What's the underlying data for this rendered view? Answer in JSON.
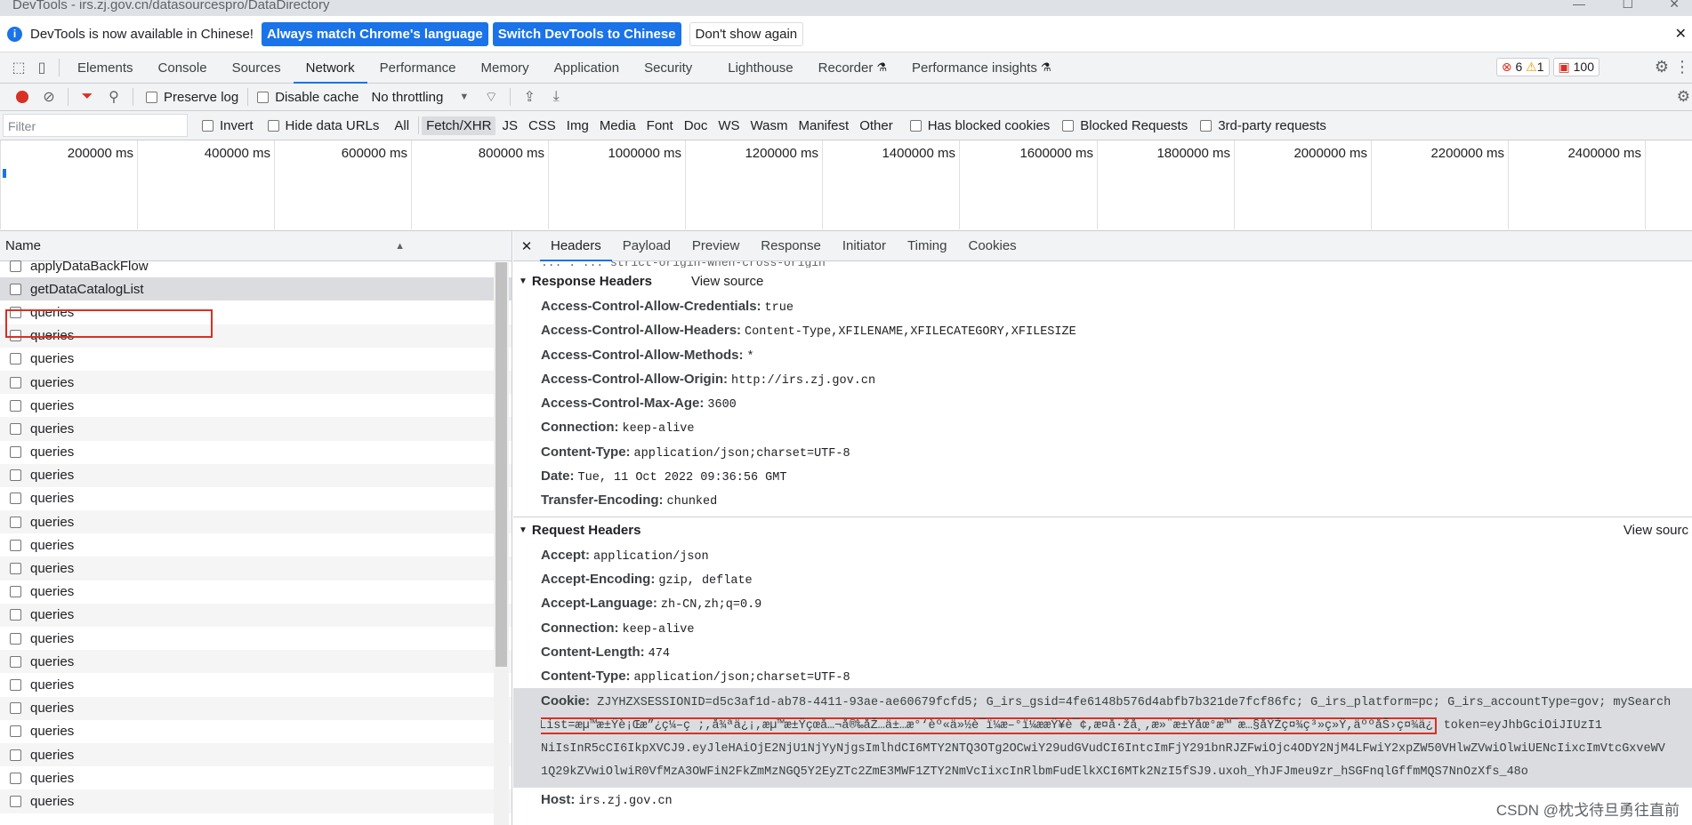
{
  "window": {
    "title": "DevTools - irs.zj.gov.cn/datasourcespro/DataDirectory"
  },
  "infobar": {
    "message": "DevTools is now available in Chinese!",
    "btn_match": "Always match Chrome's language",
    "btn_switch": "Switch DevTools to Chinese",
    "btn_dont_show": "Don't show again"
  },
  "tabs": [
    "Elements",
    "Console",
    "Sources",
    "Network",
    "Performance",
    "Memory",
    "Application",
    "Security",
    "Lighthouse",
    "Recorder",
    "Performance insights"
  ],
  "badges": {
    "errors": "6",
    "warnings": "1",
    "issues": "100"
  },
  "toolbar": {
    "preserve_log": "Preserve log",
    "disable_cache": "Disable cache",
    "throttling": "No throttling"
  },
  "filterbar": {
    "placeholder": "Filter",
    "invert": "Invert",
    "hide_data_urls": "Hide data URLs",
    "types": [
      "All",
      "Fetch/XHR",
      "JS",
      "CSS",
      "Img",
      "Media",
      "Font",
      "Doc",
      "WS",
      "Wasm",
      "Manifest",
      "Other"
    ],
    "has_blocked_cookies": "Has blocked cookies",
    "blocked_requests": "Blocked Requests",
    "third_party": "3rd-party requests"
  },
  "timeline": {
    "ticks": [
      "200000 ms",
      "400000 ms",
      "600000 ms",
      "800000 ms",
      "1000000 ms",
      "1200000 ms",
      "1400000 ms",
      "1600000 ms",
      "1800000 ms",
      "2000000 ms",
      "2200000 ms",
      "2400000 ms"
    ]
  },
  "requests": {
    "header": "Name",
    "items": [
      "applyDataBackFlow",
      "getDataCatalogList",
      "queries",
      "queries",
      "queries",
      "queries",
      "queries",
      "queries",
      "queries",
      "queries",
      "queries",
      "queries",
      "queries",
      "queries",
      "queries",
      "queries",
      "queries",
      "queries",
      "queries",
      "queries",
      "queries",
      "queries",
      "queries",
      "queries"
    ]
  },
  "detail": {
    "tabs": [
      "Headers",
      "Payload",
      "Preview",
      "Response",
      "Initiator",
      "Timing",
      "Cookies"
    ],
    "response_section": "Response Headers",
    "request_section": "Request Headers",
    "view_source": "View source",
    "view_source_right": "View sourc",
    "response_headers": [
      {
        "k": "Access-Control-Allow-Credentials:",
        "v": "true"
      },
      {
        "k": "Access-Control-Allow-Headers:",
        "v": "Content-Type,XFILENAME,XFILECATEGORY,XFILESIZE"
      },
      {
        "k": "Access-Control-Allow-Methods:",
        "v": "*"
      },
      {
        "k": "Access-Control-Allow-Origin:",
        "v": "http://irs.zj.gov.cn"
      },
      {
        "k": "Access-Control-Max-Age:",
        "v": "3600"
      },
      {
        "k": "Connection:",
        "v": "keep-alive"
      },
      {
        "k": "Content-Type:",
        "v": "application/json;charset=UTF-8"
      },
      {
        "k": "Date:",
        "v": "Tue, 11 Oct 2022 09:36:56 GMT"
      },
      {
        "k": "Transfer-Encoding:",
        "v": "chunked"
      }
    ],
    "request_headers": [
      {
        "k": "Accept:",
        "v": "application/json"
      },
      {
        "k": "Accept-Encoding:",
        "v": "gzip, deflate"
      },
      {
        "k": "Accept-Language:",
        "v": "zh-CN,zh;q=0.9"
      },
      {
        "k": "Connection:",
        "v": "keep-alive"
      },
      {
        "k": "Content-Length:",
        "v": "474"
      },
      {
        "k": "Content-Type:",
        "v": "application/json;charset=UTF-8"
      }
    ],
    "cookie_key": "Cookie:",
    "cookie_line1": "ZJYHZXSESSIONID=d5c3af1d-ab78-4411-93ae-ae60679fcfd5; G_irs_gsid=4fe6148b576d4abfb7b321de7fcf86fc; G_irs_platform=pc; G_irs_accountType=gov; mySearch",
    "cookie_line2a": "List=æµ™æ±Ÿè¡Œæ”¿ç¼–ç ;,å¾ªä¿¡,æµ™æ±Ÿçœå…¬å®‰åŽ…ä±…æ°‘èº«ä»½è¯ï¼æ–°ï¼ææŸ¥è¯¢,æ¤å·žå¸,æ»¨æ±Ÿåœ°æ™¯æ…§åŸŽç¤¾ç³»ç»Ÿ,äººåŠ›ç¤¾ä¿",
    "cookie_line2b": "token=eyJhbGciOiJIUzI1",
    "cookie_line3": "NiIsInR5cCI6IkpXVCJ9.eyJleHAiOjE2NjU1NjYyNjgsImlhdCI6MTY2NTQ3OTg2OCwiY29udGVudCI6IntcImFjY291bnRJZFwiOjc4ODY2NjM4LFwiY2xpZW50VHlwZVwiOlwiUENcIixcImVtcGxveWV",
    "cookie_line4": "1Q29kZVwiOlwiR0VfMzA3OWFiN2FkZmMzNGQ5Y2EyZTc2ZmE3MWF1ZTY2NmVcIixcInRlbmFudElkXCI6MTk2NzI5fSJ9.uxoh_YhJFJmeu9zr_hSGFnqlGffmMQS7NnOzXfs_48o",
    "host_key": "Host:",
    "host_val": "irs.zj.gov.cn",
    "partial_top": "... : ... strict-origin-when-cross-origin"
  },
  "watermark": "CSDN @枕戈待旦勇往直前"
}
